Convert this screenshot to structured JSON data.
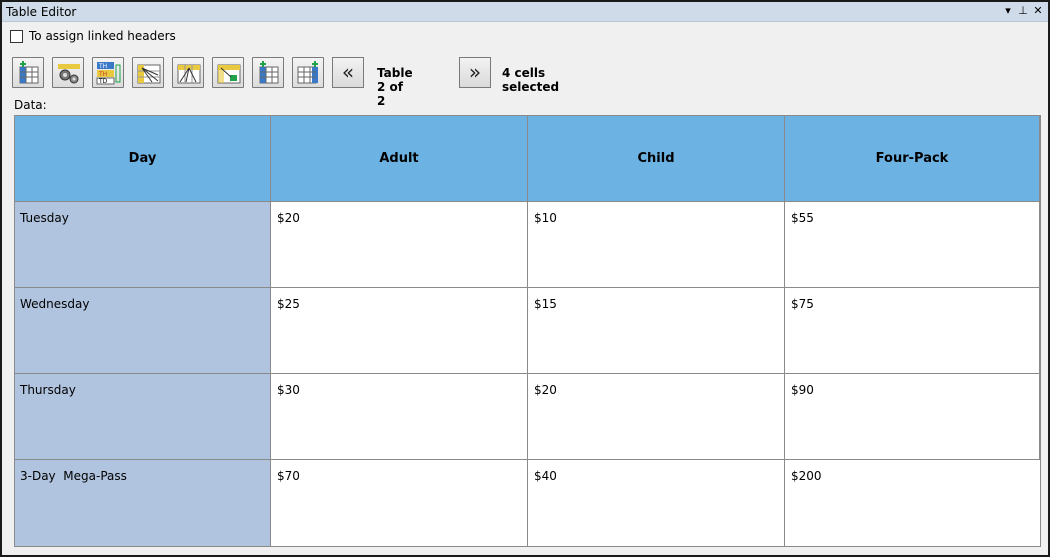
{
  "window": {
    "title": "Table Editor",
    "controls": [
      "▾",
      "⊥",
      "✕"
    ]
  },
  "options": {
    "linked_headers_label": "To assign linked headers",
    "linked_headers_checked": false
  },
  "toolbar": {
    "table_count": "Table 2 of 2",
    "prev_glyph": "«",
    "next_glyph": "»",
    "selection_status": "4 cells selected"
  },
  "data_label": "Data:",
  "table": {
    "columns": [
      "Day",
      "Adult",
      "Child",
      "Four-Pack"
    ],
    "rows": [
      {
        "header": "Tuesday",
        "cells": [
          "$20",
          "$10",
          "$55"
        ]
      },
      {
        "header": "Wednesday",
        "cells": [
          "$25",
          "$15",
          "$75"
        ]
      },
      {
        "header": "Thursday",
        "cells": [
          "$30",
          "$20",
          "$90"
        ]
      },
      {
        "header": "3-Day  Mega-Pass",
        "cells": [
          "$70",
          "$40",
          "$200"
        ]
      }
    ]
  },
  "colors": {
    "header_bg": "#6cb2e3",
    "row_header_bg": "#b0c4df",
    "titlebar_bg": "#cfdbe8"
  }
}
